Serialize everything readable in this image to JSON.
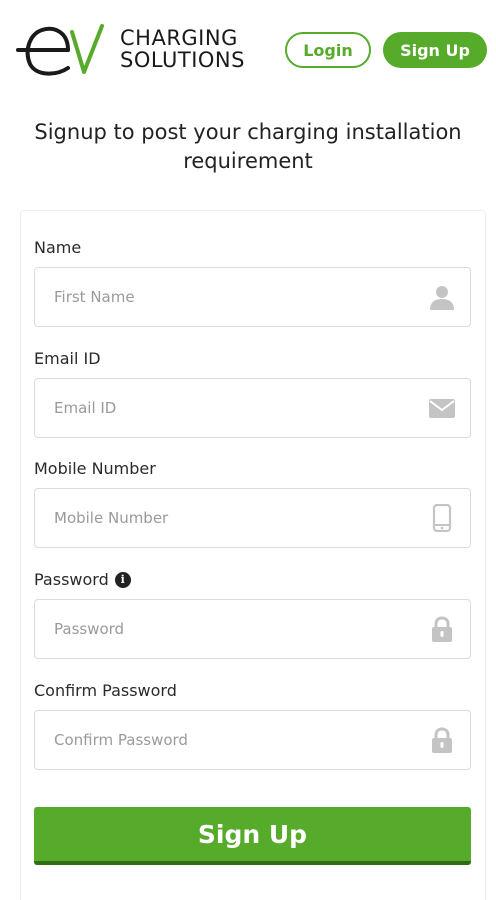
{
  "brand": {
    "logo_mark": "eV",
    "line1": "CHARGING",
    "line2": "SOLUTIONS",
    "accent_color": "#57ab2b"
  },
  "header": {
    "login_label": "Login",
    "signup_label": "Sign Up"
  },
  "page": {
    "heading": "Signup to post your charging installation requirement"
  },
  "form": {
    "name": {
      "label": "Name",
      "placeholder": "First Name",
      "icon": "user-icon"
    },
    "email": {
      "label": "Email ID",
      "placeholder": "Email ID",
      "icon": "envelope-icon"
    },
    "mobile": {
      "label": "Mobile Number",
      "placeholder": "Mobile Number",
      "icon": "mobile-phone-icon"
    },
    "password": {
      "label": "Password",
      "placeholder": "Password",
      "icon": "lock-icon",
      "info_icon": "info-icon"
    },
    "confirm_password": {
      "label": "Confirm Password",
      "placeholder": "Confirm Password",
      "icon": "lock-icon"
    },
    "submit_label": "Sign Up"
  }
}
